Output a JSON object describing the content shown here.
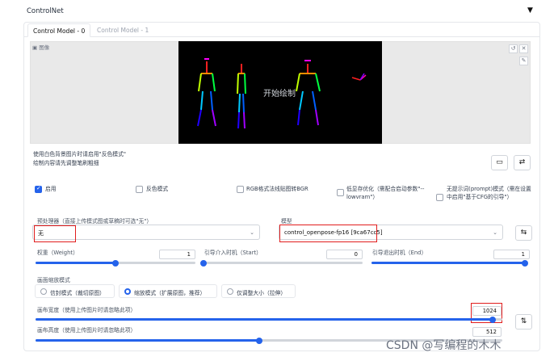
{
  "section": {
    "title": "ControlNet",
    "collapse_icon": "▼"
  },
  "tabs": [
    {
      "label": "Control Model - 0",
      "active": true
    },
    {
      "label": "Control Model - 1",
      "active": false
    }
  ],
  "image_panel": {
    "label": "图像",
    "overlay_text": "开始绘制",
    "icons": [
      "undo-icon",
      "close-icon",
      "brush-icon"
    ]
  },
  "hint": {
    "line1": "使用白色背景图片时请启用\"反色模式\"",
    "line2": "绘制内容请先调整笔刷粗细"
  },
  "checkboxes": {
    "enable": {
      "label": "启用",
      "checked": true
    },
    "invert": {
      "label": "反色模式",
      "checked": false
    },
    "rgb_bgr": {
      "label": "RGB格式法线贴图转BGR",
      "checked": false
    },
    "lowvram": {
      "label": "低显存优化（需配合启动参数\"--lowvram\"）",
      "checked": false
    },
    "guess_mode": {
      "label": "无提示词(prompt)模式（需在设置中启用\"基于CFG的引导\"）",
      "checked": false
    }
  },
  "preprocessor": {
    "label": "预处理器（直接上传模式图或草稿时可选\"无\"）",
    "value": "无"
  },
  "model": {
    "label": "模型",
    "value": "control_openpose-fp16 [9ca67cc5]"
  },
  "weight": {
    "label": "权重（Weight）",
    "value": "1",
    "fraction": 0.5
  },
  "guidance_start": {
    "label": "引导介入时机（Start）",
    "value": "0",
    "fraction": 0.0
  },
  "guidance_end": {
    "label": "引导退出时机（End）",
    "value": "1",
    "fraction": 1.0
  },
  "resize_mode": {
    "label": "画面缩放模式",
    "options": [
      {
        "label": "信封模式（裁切原图）",
        "selected": false
      },
      {
        "label": "缩放模式（扩展原图，推荐）",
        "selected": true
      },
      {
        "label": "仅调整大小（拉伸）",
        "selected": false
      }
    ]
  },
  "canvas_width": {
    "label": "画布宽度（使用上传图片时请忽略此项）",
    "value": "1024",
    "fraction": 0.98
  },
  "canvas_height": {
    "label": "画布高度（使用上传图片时请忽略此项）",
    "value": "512",
    "fraction": 0.48
  },
  "watermark": "CSDN @写编程的木木",
  "colors": {
    "accent": "#2563eb",
    "highlight": "#e11d1d"
  }
}
